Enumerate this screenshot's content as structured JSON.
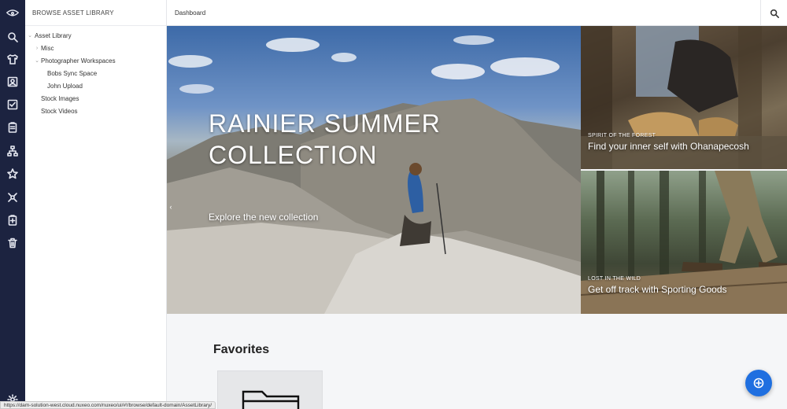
{
  "rail": {
    "icons": [
      "logo-icon",
      "search-icon",
      "shirt-icon",
      "contact-card-icon",
      "checkbox-icon",
      "clipboard-icon",
      "hierarchy-icon",
      "star-icon",
      "collections-icon",
      "clipboard-check-icon",
      "trash-icon",
      "settings-icon"
    ]
  },
  "tree": {
    "header": "BROWSE ASSET LIBRARY",
    "items": [
      {
        "label": "Asset Library",
        "toggle": "⌄"
      },
      {
        "label": "Misc",
        "toggle": "›"
      },
      {
        "label": "Photographer Workspaces",
        "toggle": "⌄"
      },
      {
        "label": "Bobs Sync Space"
      },
      {
        "label": "John Upload"
      },
      {
        "label": "Stock Images"
      },
      {
        "label": "Stock Videos"
      }
    ]
  },
  "topbar": {
    "breadcrumb": "Dashboard"
  },
  "hero": {
    "title": "RAINIER SUMMER COLLECTION",
    "subtitle": "Explore the new collection",
    "prev_glyph": "‹"
  },
  "cards": [
    {
      "kicker": "SPIRIT OF THE FOREST",
      "headline": "Find your inner self with Ohanapecosh"
    },
    {
      "kicker": "LOST IN THE WILD",
      "headline": "Get off track with Sporting Goods"
    }
  ],
  "favorites": {
    "title": "Favorites"
  },
  "status_url": "https://dam-solution-west.cloud.nuxeo.com/nuxeo/ui/#!/browse/default-domain/AssetLibrary/",
  "colors": {
    "rail": "#1c2340",
    "fab": "#1f6fe0",
    "page_bg": "#f5f6f8"
  }
}
